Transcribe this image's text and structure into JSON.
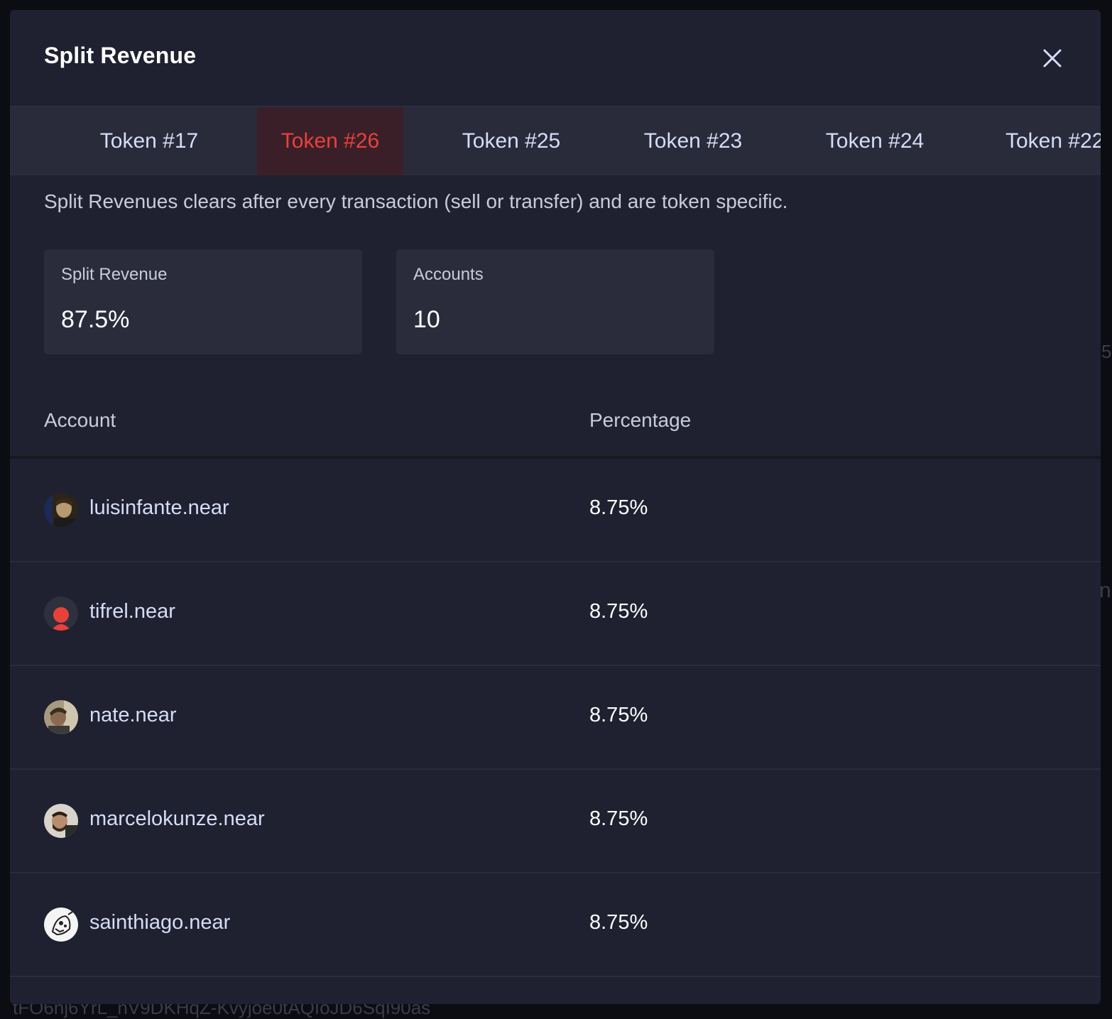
{
  "background": {
    "leak_text": "tFO6nj6YrL_nV9DKHqZ-Kvyjoe0tAQIoJD6SqI90as",
    "right_fragment_1": "5",
    "right_fragment_2": "n"
  },
  "modal": {
    "title": "Split Revenue",
    "close_icon": "close-icon"
  },
  "tabs": [
    {
      "label": "Token #17",
      "active": false
    },
    {
      "label": "Token #26",
      "active": true
    },
    {
      "label": "Token #25",
      "active": false
    },
    {
      "label": "Token #23",
      "active": false
    },
    {
      "label": "Token #24",
      "active": false
    },
    {
      "label": "Token #22",
      "active": false
    }
  ],
  "description": "Split Revenues clears after every transaction (sell or transfer) and are token specific.",
  "stats": {
    "split_revenue": {
      "label": "Split Revenue",
      "value": "87.5%"
    },
    "accounts": {
      "label": "Accounts",
      "value": "10"
    }
  },
  "table": {
    "headers": {
      "account": "Account",
      "percentage": "Percentage"
    },
    "rows": [
      {
        "account": "luisinfante.near",
        "percentage": "8.75%",
        "avatar": "portrait-avatar"
      },
      {
        "account": "tifrel.near",
        "percentage": "8.75%",
        "avatar": "red-user-avatar"
      },
      {
        "account": "nate.near",
        "percentage": "8.75%",
        "avatar": "portrait-avatar"
      },
      {
        "account": "marcelokunze.near",
        "percentage": "8.75%",
        "avatar": "portrait-avatar"
      },
      {
        "account": "sainthiago.near",
        "percentage": "8.75%",
        "avatar": "sketch-avatar"
      }
    ]
  },
  "colors": {
    "modal_bg": "#1f2130",
    "tab_bar_bg": "#292b3a",
    "active_tab_bg": "#3a1f29",
    "active_tab_text": "#e8413a",
    "link_text": "#d6dcf7"
  }
}
